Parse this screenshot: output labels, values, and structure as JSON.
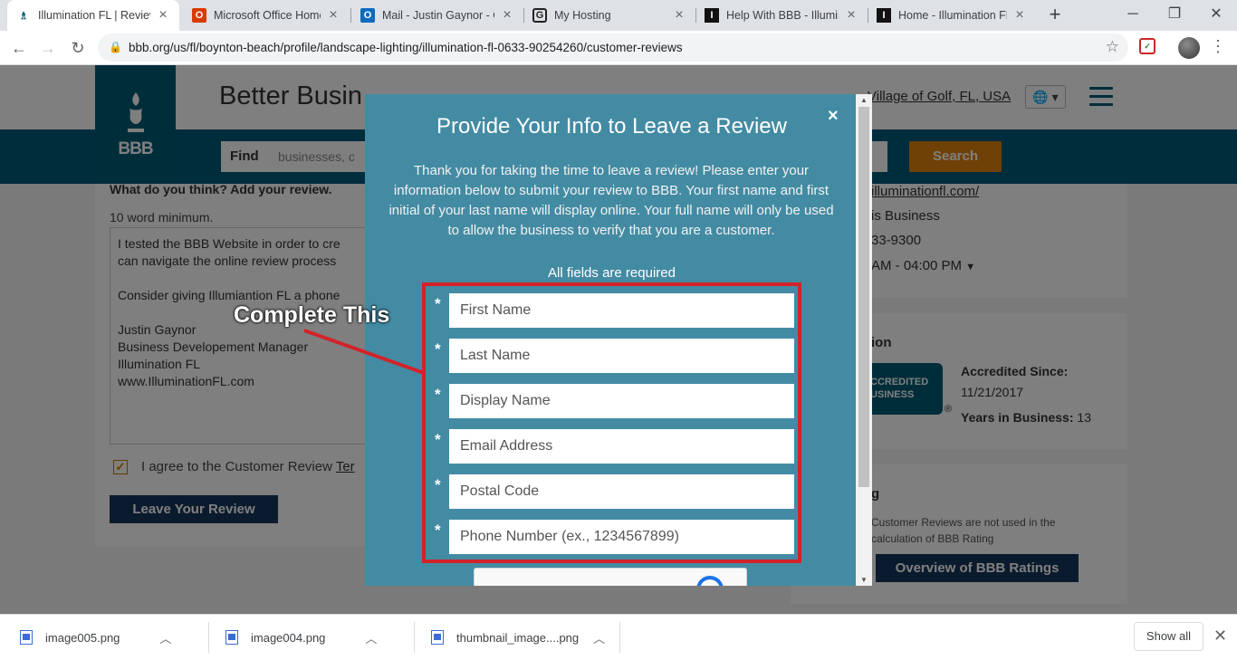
{
  "browser": {
    "tabs": [
      {
        "title": "Illumination FL | Review",
        "icon": "bbb-favicon",
        "active": true
      },
      {
        "title": "Microsoft Office Home",
        "icon": "office-favicon"
      },
      {
        "title": "Mail - Justin Gaynor - O",
        "icon": "outlook-favicon"
      },
      {
        "title": "My Hosting",
        "icon": "godaddy-favicon"
      },
      {
        "title": "Help With BBB - Illumin",
        "icon": "illumination-favicon"
      },
      {
        "title": "Home - Illumination FL",
        "icon": "illumination-favicon"
      }
    ],
    "new_tab": "+",
    "window": {
      "minimize": "─",
      "maximize": "❐",
      "close": "✕"
    },
    "nav": {
      "back": "←",
      "forward": "→",
      "reload": "↻"
    },
    "url": "bbb.org/us/fl/boynton-beach/profile/landscape-lighting/illumination-fl-0633-90254260/customer-reviews"
  },
  "site": {
    "logo_text": "BBB",
    "title": "Better Business Bureau",
    "title_visible": "Better Busin",
    "location_link": "Village of Golf, FL, USA",
    "find_label": "Find",
    "find_placeholder": "businesses, c",
    "search_button": "Search"
  },
  "review_form": {
    "prompt": "What do you think? Add your review.",
    "min_words": "10 word minimum.",
    "review_text": "I tested the BBB Website in order to cre\ncan navigate the online review process\n\nConsider giving Illumiantion FL a phone\n\nJustin Gaynor\nBusiness Developement Manager\nIllumination FL\nwww.IlluminationFL.com",
    "agree_text": "I agree to the Customer Review ",
    "agree_link": "Ter",
    "agree_checked": "✓",
    "submit_button": "Leave Your Review"
  },
  "sidebar": {
    "website": "illuminationfl.com/",
    "contact_partial": "is Business",
    "phone_partial": "33-9300",
    "hours_partial": "AM - 04:00 PM",
    "accreditation_heading_partial": "ion",
    "seal_text_line1": "CCREDITED",
    "seal_text_line2": "USINESS",
    "accredited_since_label": "Accredited Since:",
    "accredited_since_value": "11/21/2017",
    "years_label": "Years in Business:",
    "years_value": "13",
    "rating_heading_partial": "g",
    "rating_note": "Customer Reviews are not used in the calculation of BBB Rating",
    "overview_button": "Overview of BBB Ratings"
  },
  "modal": {
    "title": "Provide Your Info to Leave a Review",
    "close": "×",
    "body": "Thank you for taking the time to leave a review! Please enter your information below to submit your review to BBB. Your first name and first initial of your last name will display online. Your full name will only be used to allow the business to verify that you are a customer.",
    "required_note": "All fields are required",
    "required_marker": "*",
    "fields": [
      {
        "placeholder": "First Name",
        "value": ""
      },
      {
        "placeholder": "Last Name",
        "value": ""
      },
      {
        "placeholder": "Display Name",
        "value": ""
      },
      {
        "placeholder": "Email Address",
        "value": ""
      },
      {
        "placeholder": "Postal Code",
        "value": ""
      },
      {
        "placeholder": "Phone Number (ex., 1234567899)",
        "value": ""
      }
    ]
  },
  "annotation": {
    "callout": "Complete This",
    "color": "#d2232a"
  },
  "downloads": {
    "items": [
      {
        "name": "image005.png"
      },
      {
        "name": "image004.png"
      },
      {
        "name": "thumbnail_image....png"
      }
    ],
    "show_all": "Show all",
    "close": "✕"
  },
  "colors": {
    "bbb_teal": "#005a78",
    "modal_bg": "#438ba3",
    "search_orange": "#e0830f",
    "navy_button": "#15365b",
    "highlight_red": "#d2232a"
  }
}
